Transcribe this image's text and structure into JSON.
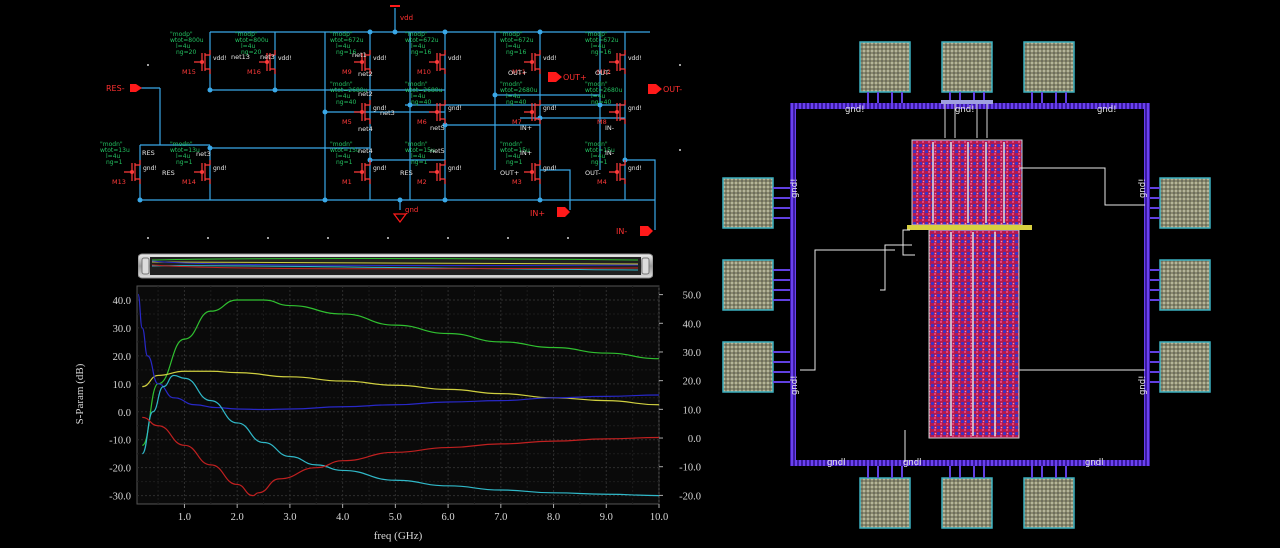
{
  "schematic": {
    "pins": {
      "vdd": "vdd",
      "gnd": "gnd",
      "res": "RES-",
      "out_p": "OUT+",
      "out_m": "OUT-",
      "in_p": "IN+",
      "in_m": "IN-"
    },
    "transistors": [
      {
        "name": "M15",
        "model": "\"modp\"",
        "wtot": "wtot=800u",
        "l": "l=4u",
        "ng": "ng=20",
        "term": "vdd!"
      },
      {
        "name": "M16",
        "model": "\"modp\"",
        "wtot": "wtot=800u",
        "l": "l=4u",
        "ng": "ng=20",
        "term": "vdd!"
      },
      {
        "name": "M9",
        "model": "\"modp\"",
        "wtot": "wtot=672u",
        "l": "l=4u",
        "ng": "ng=16",
        "term": "vdd!"
      },
      {
        "name": "M10",
        "model": "\"modp\"",
        "wtot": "wtot=672u",
        "l": "l=4u",
        "ng": "ng=16",
        "term": "vdd!"
      },
      {
        "name": "M11",
        "model": "\"modp\"",
        "wtot": "wtot=672u",
        "l": "l=4u",
        "ng": "ng=16",
        "term": "vdd!"
      },
      {
        "name": "M12",
        "model": "\"modp\"",
        "wtot": "wtot=672u",
        "l": "l=4u",
        "ng": "ng=16",
        "term": "vdd!"
      },
      {
        "name": "M5",
        "model": "\"modn\"",
        "wtot": "wtot=2680u",
        "l": "l=4u",
        "ng": "ng=40",
        "term": "gnd!"
      },
      {
        "name": "M6",
        "model": "\"modn\"",
        "wtot": "wtot=2680u",
        "l": "l=4u",
        "ng": "ng=40",
        "term": "gnd!"
      },
      {
        "name": "M7",
        "model": "\"modn\"",
        "wtot": "wtot=2680u",
        "l": "l=4u",
        "ng": "ng=40",
        "term": "gnd!"
      },
      {
        "name": "M8",
        "model": "\"modn\"",
        "wtot": "wtot=2680u",
        "l": "l=4u",
        "ng": "ng=40",
        "term": "gnd!"
      },
      {
        "name": "M13",
        "model": "\"modn\"",
        "wtot": "wtot=13u",
        "l": "l=4u",
        "ng": "ng=1",
        "term": "gnd!"
      },
      {
        "name": "M14",
        "model": "\"modn\"",
        "wtot": "wtot=13u",
        "l": "l=4u",
        "ng": "ng=1",
        "term": "gnd!"
      },
      {
        "name": "M1",
        "model": "\"modn\"",
        "wtot": "wtot=15u",
        "l": "l=4u",
        "ng": "ng=1",
        "term": "gnd!"
      },
      {
        "name": "M2",
        "model": "\"modn\"",
        "wtot": "wtot=15u",
        "l": "l=4u",
        "ng": "ng=1",
        "term": "gnd!"
      },
      {
        "name": "M3",
        "model": "\"modn\"",
        "wtot": "wtot=15u",
        "l": "l=4u",
        "ng": "ng=1",
        "term": "gnd!"
      },
      {
        "name": "M4",
        "model": "\"modn\"",
        "wtot": "wtot=15u",
        "l": "l=4u",
        "ng": "ng=1",
        "term": "gnd!"
      }
    ],
    "nets": {
      "net1": "net1",
      "net2": "net2",
      "net3": "net3",
      "net4": "net4",
      "net5": "net5",
      "net13": "net13",
      "res": "RES",
      "out_p": "OUT+",
      "out_m": "OUT-",
      "in_p": "IN+",
      "in_m": "IN-"
    },
    "colors": {
      "wire": "#3aa8e8",
      "pin": "#ff1a1a",
      "label": "#22c060",
      "device": "#ff3a3a"
    }
  },
  "plot": {
    "ylabel": "S-Param (dB)",
    "xlabel": "freq (GHz)"
  },
  "chart_data": {
    "type": "line",
    "xlim": [
      0.1,
      10.0
    ],
    "left_axis": {
      "ylim": [
        -33,
        45
      ],
      "ticks": [
        "40.0",
        "30.0",
        "20.0",
        "10.0",
        "0.0",
        "-10.0",
        "-20.0",
        "-30.0"
      ]
    },
    "right_axis": {
      "ylim": [
        -23,
        53
      ],
      "ticks": [
        "50.0",
        "40.0",
        "30.0",
        "20.0",
        "10.0",
        "0.0",
        "-10.0",
        "-20.0"
      ]
    },
    "x_ticks": [
      "1.0",
      "2.0",
      "3.0",
      "4.0",
      "5.0",
      "6.0",
      "7.0",
      "8.0",
      "9.0",
      "10.0"
    ],
    "grid": true,
    "series": [
      {
        "color": "#30c030",
        "x": [
          0.2,
          0.5,
          1.0,
          1.5,
          2.0,
          2.5,
          3.0,
          4.0,
          5.0,
          6.0,
          7.0,
          8.0,
          9.0,
          10.0
        ],
        "y": [
          -12,
          10,
          26,
          36,
          40,
          40,
          38,
          35,
          31,
          28,
          25,
          23,
          21,
          19
        ]
      },
      {
        "color": "#d0d040",
        "x": [
          0.2,
          0.5,
          1.0,
          1.5,
          2.0,
          3.0,
          4.0,
          5.0,
          6.0,
          7.0,
          8.0,
          9.0,
          10.0
        ],
        "y": [
          9,
          13,
          14.5,
          14.5,
          14,
          12.5,
          11,
          9.5,
          8,
          6.5,
          5,
          4,
          2.5
        ]
      },
      {
        "color": "#2828c8",
        "x": [
          0.12,
          0.2,
          0.3,
          0.5,
          0.8,
          1.2,
          1.6,
          2.0,
          2.5,
          3.0,
          4.0,
          5.0,
          6.0,
          7.0,
          8.0,
          9.0,
          10.0
        ],
        "y": [
          42,
          30,
          20,
          10,
          5,
          2.5,
          1.5,
          1,
          0.8,
          1,
          1.8,
          2.5,
          3.5,
          4,
          5,
          5.5,
          6
        ]
      },
      {
        "color": "#30b8c8",
        "x": [
          0.2,
          0.4,
          0.6,
          0.8,
          1.0,
          1.5,
          2.0,
          2.5,
          3.0,
          3.5,
          4.0,
          5.0,
          6.0,
          7.0,
          8.0,
          9.0,
          10.0
        ],
        "y": [
          -15,
          0,
          9,
          13,
          12,
          4,
          -4,
          -11,
          -16,
          -19,
          -21,
          -24.5,
          -26.5,
          -28,
          -29,
          -29.5,
          -30
        ]
      },
      {
        "color": "#c02020",
        "x": [
          0.2,
          0.5,
          1.0,
          1.5,
          2.0,
          2.3,
          2.4,
          2.8,
          3.5,
          4.0,
          5.0,
          6.0,
          7.0,
          8.0,
          9.0,
          10.0
        ],
        "y": [
          -2,
          -5,
          -12,
          -19,
          -26,
          -30,
          -29,
          -24,
          -20,
          -17.5,
          -14.5,
          -12.8,
          -11.5,
          -10.5,
          -9.7,
          -9.2
        ]
      }
    ]
  },
  "layout": {
    "labels": {
      "top_left": "gnd!",
      "top_center": "gnd!",
      "top_right": "gnd!",
      "bottom_left": "gndl",
      "bottom_center": "gndl",
      "bottom_right": "gndl",
      "side_left": "gnd!",
      "side_right": "gnd!"
    },
    "colors": {
      "ring": "#6030e0",
      "pad": "#9a9a7a",
      "fill_red": "#c81a48",
      "fill_blue": "#3a2ab8"
    }
  }
}
